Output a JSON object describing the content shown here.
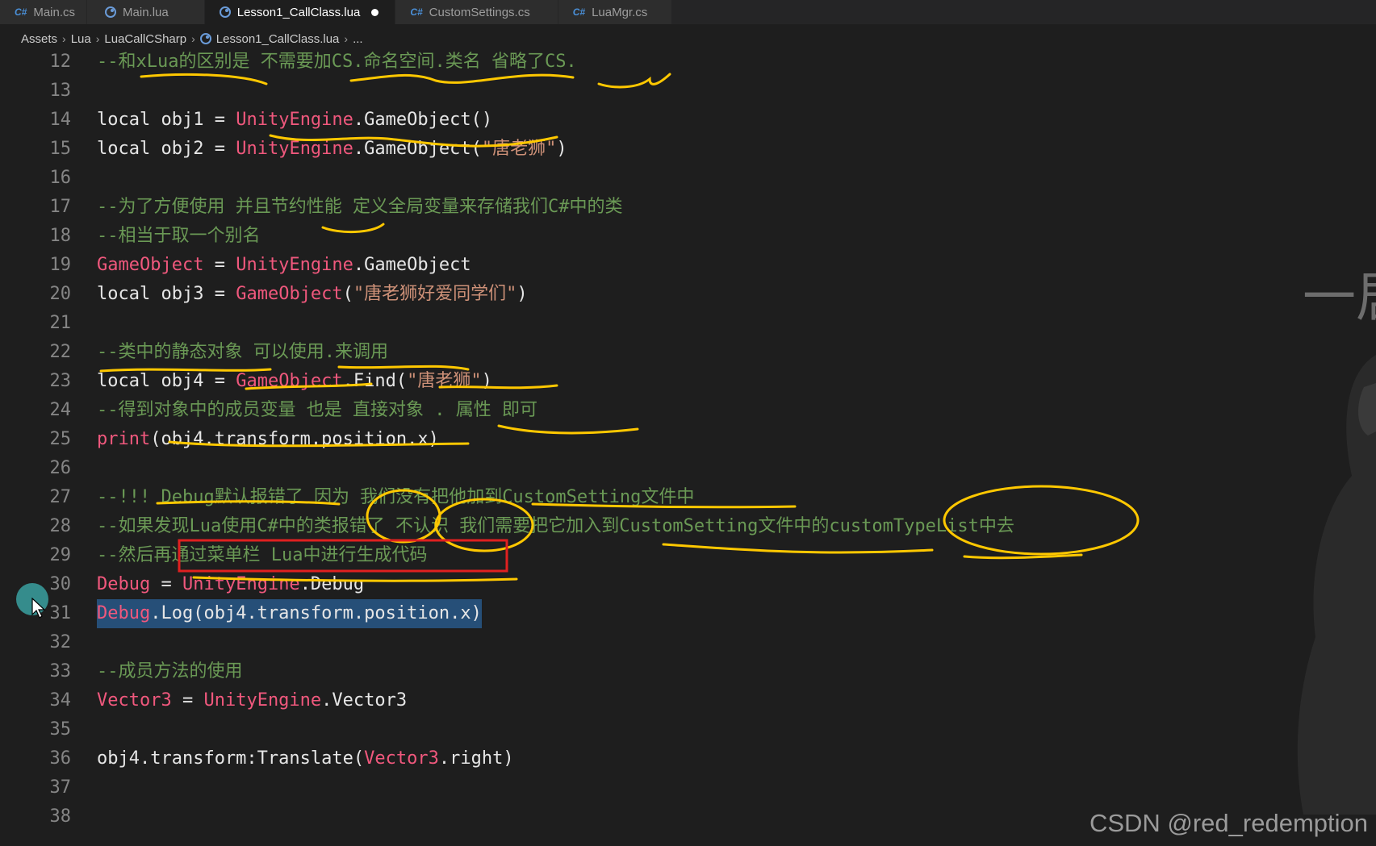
{
  "tabs": [
    {
      "icon": "csharp-icon",
      "label": "Main.cs",
      "active": false
    },
    {
      "icon": "lua-icon",
      "label": "Main.lua",
      "active": false
    },
    {
      "icon": "lua-icon",
      "label": "Lesson1_CallClass.lua",
      "active": true,
      "modified": true
    },
    {
      "icon": "csharp-icon",
      "label": "CustomSettings.cs",
      "active": false
    },
    {
      "icon": "csharp-icon",
      "label": "LuaMgr.cs",
      "active": false
    }
  ],
  "tab_icon_text": {
    "csharp": "C#"
  },
  "breadcrumb": [
    "Assets",
    "Lua",
    "LuaCallCSharp",
    "Lesson1_CallClass.lua",
    "..."
  ],
  "line_numbers": [
    "12",
    "13",
    "14",
    "15",
    "16",
    "17",
    "18",
    "19",
    "20",
    "21",
    "22",
    "23",
    "24",
    "25",
    "26",
    "27",
    "28",
    "29",
    "30",
    "31",
    "32",
    "33",
    "34",
    "35",
    "36",
    "37",
    "38"
  ],
  "code": {
    "l12": "--和xLua的区别是 不需要加CS.命名空间.类名 省略了CS.",
    "l14": {
      "kw": "local",
      "var": "obj1",
      "eq": "=",
      "ns": "UnityEngine",
      "call": ".GameObject()"
    },
    "l15": {
      "kw": "local",
      "var": "obj2",
      "eq": "=",
      "ns": "UnityEngine",
      "call": ".GameObject(",
      "str": "\"唐老狮\"",
      "end": ")"
    },
    "l17": "--为了方便使用 并且节约性能 定义全局变量来存储我们C#中的类",
    "l18": "--相当于取一个别名",
    "l19": {
      "cls": "GameObject",
      "eq": "=",
      "ns": "UnityEngine",
      "rest": ".GameObject"
    },
    "l20": {
      "kw": "local",
      "var": "obj3",
      "eq": "=",
      "cls": "GameObject",
      "open": "(",
      "str": "\"唐老狮好爱同学们\"",
      "end": ")"
    },
    "l22": "--类中的静态对象 可以使用.来调用",
    "l23": {
      "kw": "local",
      "var": "obj4",
      "eq": "=",
      "cls": "GameObject",
      "rest": ".Find(",
      "str": "\"唐老狮\"",
      "end": ")"
    },
    "l24": "--得到对象中的成员变量 也是 直接对象 . 属性 即可",
    "l25": {
      "fn": "print",
      "rest": "(obj4.transform.position.x)"
    },
    "l27": "--!!! Debug默认报错了 因为 我们没有把他加到CustomSetting文件中",
    "l28": "--如果发现Lua使用C#中的类报错了 不认识 我们需要把它加入到CustomSetting文件中的customTypeList中去",
    "l29": "--然后再通过菜单栏 Lua中进行生成代码",
    "l30": {
      "cls": "Debug",
      "eq": "=",
      "ns": "UnityEngine",
      "rest": ".Debug"
    },
    "l31": {
      "cls": "Debug",
      "rest": ".Log(obj4.transform.position.x)"
    },
    "l33": "--成员方法的使用",
    "l34": {
      "cls": "Vector3",
      "eq": "=",
      "ns": "UnityEngine",
      "rest": ".Vector3"
    },
    "l36": {
      "pre": "obj4.transform:Translate(",
      "cls": "Vector3",
      "rest": ".right)"
    }
  },
  "side_text": "一居",
  "watermark": "CSDN @red_redemption",
  "colors": {
    "background": "#1e1e1e",
    "comment": "#6a9955",
    "class": "#f0587d",
    "string": "#ce9178",
    "annotation_yellow": "#ffc800",
    "annotation_red": "#e02020"
  }
}
